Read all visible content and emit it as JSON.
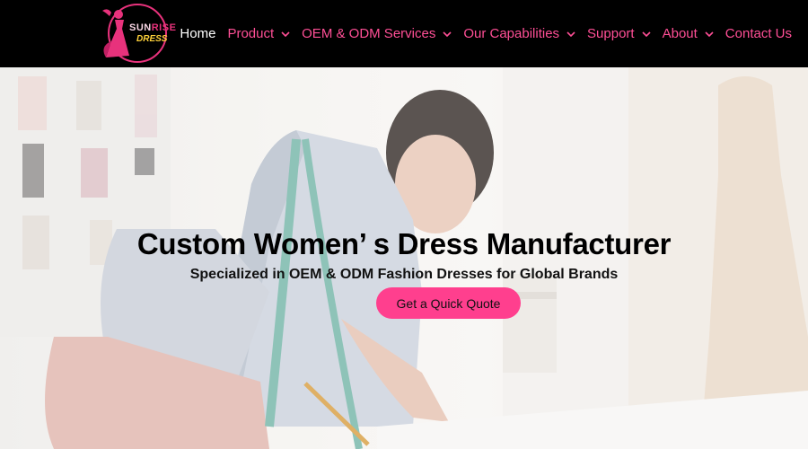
{
  "brand": {
    "logo_text_part1": "SUN",
    "logo_text_part2": "RISE",
    "logo_text_part3": "DRESS"
  },
  "nav": {
    "items": [
      {
        "label": "Home",
        "active": true,
        "dropdown": false
      },
      {
        "label": "Product",
        "active": false,
        "dropdown": true
      },
      {
        "label": "OEM & ODM Services",
        "active": false,
        "dropdown": true
      },
      {
        "label": "Our Capabilities",
        "active": false,
        "dropdown": true
      },
      {
        "label": "Support",
        "active": false,
        "dropdown": true
      },
      {
        "label": "About",
        "active": false,
        "dropdown": true
      },
      {
        "label": "Contact Us",
        "active": false,
        "dropdown": false
      }
    ]
  },
  "hero": {
    "title": "Custom Women’ s Dress Manufacturer",
    "subtitle": "Specialized in OEM & ODM Fashion Dresses for Global Brands",
    "cta_label": "Get a Quick Quote"
  },
  "colors": {
    "header_bg": "#000000",
    "accent_pink": "#ff3f8e",
    "nav_text": "#ff4f96",
    "nav_active": "#ffffff"
  }
}
